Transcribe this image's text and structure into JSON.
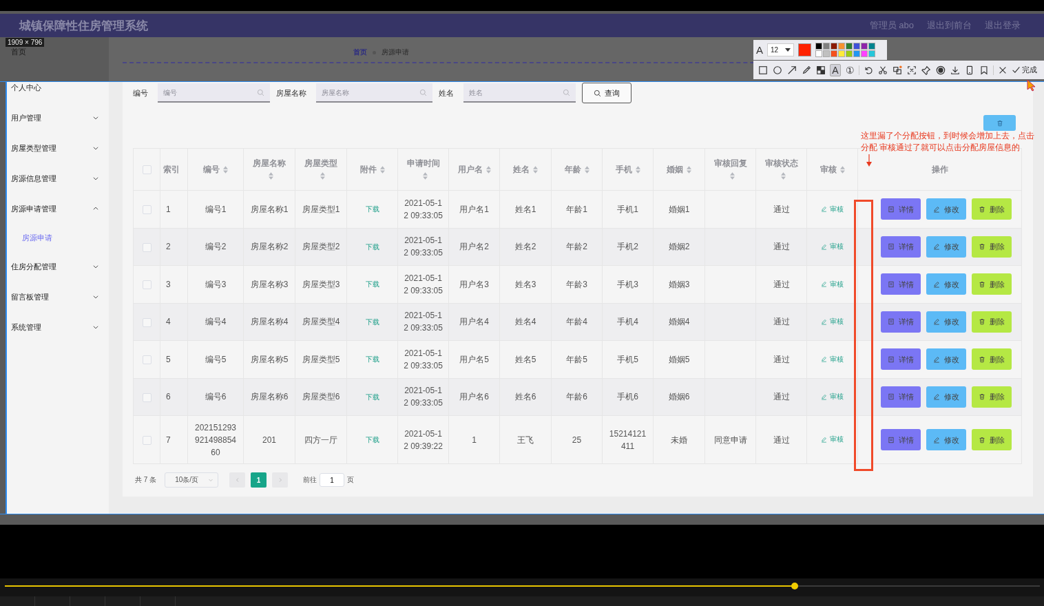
{
  "header": {
    "title": "城镇保障性住房管理系统",
    "links": [
      "管理员 abo",
      "退出到前台",
      "退出登录"
    ]
  },
  "size_badge": "1909 × 796",
  "sidebar": {
    "items": [
      {
        "label": "首页"
      },
      {
        "label": "个人中心"
      },
      {
        "label": "用户管理",
        "expanded": false
      },
      {
        "label": "房屋类型管理",
        "expanded": false
      },
      {
        "label": "房源信息管理",
        "expanded": false
      },
      {
        "label": "房源申请管理",
        "expanded": true,
        "children": [
          {
            "label": "房源申请",
            "selected": true
          }
        ]
      },
      {
        "label": "住房分配管理",
        "expanded": false
      },
      {
        "label": "留言板管理",
        "expanded": false
      },
      {
        "label": "系统管理",
        "expanded": false
      }
    ]
  },
  "breadcrumb": [
    "首页",
    "房源申请"
  ],
  "search": {
    "fields": [
      {
        "label": "编号",
        "placeholder": "编号"
      },
      {
        "label": "房屋名称",
        "placeholder": "房屋名称"
      },
      {
        "label": "姓名",
        "placeholder": "姓名"
      }
    ],
    "button": "查询"
  },
  "table": {
    "columns": [
      {
        "kind": "checkbox",
        "checked": false
      },
      {
        "kind": "text",
        "label": "索引",
        "sortable": false
      },
      {
        "kind": "text",
        "label": "编号",
        "sortable": true
      },
      {
        "kind": "text",
        "label": "房屋名称",
        "sortable": true
      },
      {
        "kind": "text",
        "label": "房屋类型",
        "sortable": true
      },
      {
        "kind": "text",
        "label": "附件",
        "sortable": true
      },
      {
        "kind": "text",
        "label": "申请时间",
        "sortable": true
      },
      {
        "kind": "text",
        "label": "用户名",
        "sortable": true
      },
      {
        "kind": "text",
        "label": "姓名",
        "sortable": true
      },
      {
        "kind": "text",
        "label": "年龄",
        "sortable": true
      },
      {
        "kind": "text",
        "label": "手机",
        "sortable": true
      },
      {
        "kind": "text",
        "label": "婚姻",
        "sortable": true
      },
      {
        "kind": "text",
        "label": "审核回复",
        "sortable": true
      },
      {
        "kind": "text",
        "label": "审核状态",
        "sortable": true
      },
      {
        "kind": "text",
        "label": "审核",
        "sortable": true
      },
      {
        "kind": "text",
        "label": "操作",
        "sortable": false
      }
    ],
    "rows": [
      {
        "checked": false,
        "index": "1",
        "number": "编号1",
        "house_name": "房屋名称1",
        "house_type": "房屋类型1",
        "attachment": "下载",
        "apply_time": "2021-05-12 09:33:05",
        "username": "用户名1",
        "name": "姓名1",
        "age": "年龄1",
        "phone": "手机1",
        "marriage": "婚姻1",
        "status": "通过",
        "audit": "审核",
        "actions": [
          "详情",
          "修改",
          "删除"
        ]
      },
      {
        "checked": false,
        "index": "2",
        "number": "编号2",
        "house_name": "房屋名称2",
        "house_type": "房屋类型2",
        "attachment": "下载",
        "apply_time": "2021-05-12 09:33:05",
        "username": "用户名2",
        "name": "姓名2",
        "age": "年龄2",
        "phone": "手机2",
        "marriage": "婚姻2",
        "status": "通过",
        "audit": "审核",
        "actions": [
          "详情",
          "修改",
          "删除"
        ]
      },
      {
        "checked": false,
        "index": "3",
        "number": "编号3",
        "house_name": "房屋名称3",
        "house_type": "房屋类型3",
        "attachment": "下载",
        "apply_time": "2021-05-12 09:33:05",
        "username": "用户名3",
        "name": "姓名3",
        "age": "年龄3",
        "phone": "手机3",
        "marriage": "婚姻3",
        "status": "通过",
        "audit": "审核",
        "actions": [
          "详情",
          "修改",
          "删除"
        ]
      },
      {
        "checked": false,
        "index": "4",
        "number": "编号4",
        "house_name": "房屋名称4",
        "house_type": "房屋类型4",
        "attachment": "下载",
        "apply_time": "2021-05-12 09:33:05",
        "username": "用户名4",
        "name": "姓名4",
        "age": "年龄4",
        "phone": "手机4",
        "marriage": "婚姻4",
        "status": "通过",
        "audit": "审核",
        "actions": [
          "详情",
          "修改",
          "删除"
        ]
      },
      {
        "checked": false,
        "index": "5",
        "number": "编号5",
        "house_name": "房屋名称5",
        "house_type": "房屋类型5",
        "attachment": "下载",
        "apply_time": "2021-05-12 09:33:05",
        "username": "用户名5",
        "name": "姓名5",
        "age": "年龄5",
        "phone": "手机5",
        "marriage": "婚姻5",
        "status": "通过",
        "audit": "审核",
        "actions": [
          "详情",
          "修改",
          "删除"
        ]
      },
      {
        "checked": false,
        "index": "6",
        "number": "编号6",
        "house_name": "房屋名称6",
        "house_type": "房屋类型6",
        "attachment": "下载",
        "apply_time": "2021-05-12 09:33:05",
        "username": "用户名6",
        "name": "姓名6",
        "age": "年龄6",
        "phone": "手机6",
        "marriage": "婚姻6",
        "status": "通过",
        "audit": "审核",
        "actions": [
          "详情",
          "修改",
          "删除"
        ]
      },
      {
        "checked": false,
        "index": "7",
        "number": "20215129392149885460",
        "house_name": "201",
        "house_type": "四方一厅",
        "attachment": "下载",
        "apply_time": "2021-05-12 09:39:22",
        "username": "1",
        "name": "王飞",
        "age": "25",
        "phone": "15214121411",
        "marriage": "未婚",
        "reply": "同意申请",
        "status": "通过",
        "audit": "审核",
        "actions": [
          "详情",
          "修改",
          "删除"
        ]
      }
    ]
  },
  "pagination": {
    "total": "共 7 条",
    "page_size": "10条/页",
    "pages": [
      {
        "label": "1",
        "selected": true
      }
    ],
    "goto_label": "前往",
    "goto_value": "1",
    "goto_suffix": "页"
  },
  "annotation": {
    "text": "这里漏了个分配按钮，到时候会增加上去，点击分配 审核通过了就可以点击分配房屋信息的"
  },
  "toolbar": {
    "font_label": "A",
    "font_size": "12",
    "current": {
      "color": "#ff2200"
    },
    "palette": [
      {
        "color": "#000000"
      },
      {
        "color": "#808080"
      },
      {
        "color": "#8b1a00"
      },
      {
        "color": "#f79230"
      },
      {
        "color": "#2e7d32"
      },
      {
        "color": "#3f51d8"
      },
      {
        "color": "#8e24aa"
      },
      {
        "color": "#00838f"
      },
      {
        "color": "#ffffff"
      },
      {
        "color": "#c0c0c0"
      },
      {
        "color": "#f4511e"
      },
      {
        "color": "#ffeb3b"
      },
      {
        "color": "#9ccc14"
      },
      {
        "color": "#2196f3"
      },
      {
        "color": "#ff40ff"
      },
      {
        "color": "#26c6da"
      }
    ],
    "tools": [
      {
        "kind": "rect",
        "selected": false
      },
      {
        "kind": "ellipse",
        "selected": false
      },
      {
        "kind": "arrow",
        "selected": false
      },
      {
        "kind": "pencil",
        "selected": false
      },
      {
        "kind": "mosaic",
        "selected": false
      },
      {
        "kind": "text",
        "glyph": "A",
        "selected": true
      },
      {
        "kind": "number",
        "glyph": "①",
        "selected": false
      },
      {
        "kind": "undo"
      },
      {
        "kind": "scissors"
      },
      {
        "kind": "ocr"
      },
      {
        "kind": "scan"
      },
      {
        "kind": "pin"
      },
      {
        "kind": "record"
      },
      {
        "kind": "download"
      },
      {
        "kind": "phone"
      },
      {
        "kind": "bookmark"
      },
      {
        "kind": "close"
      },
      {
        "kind": "done",
        "label": "完成"
      }
    ]
  },
  "player": {
    "level": 0.763
  }
}
